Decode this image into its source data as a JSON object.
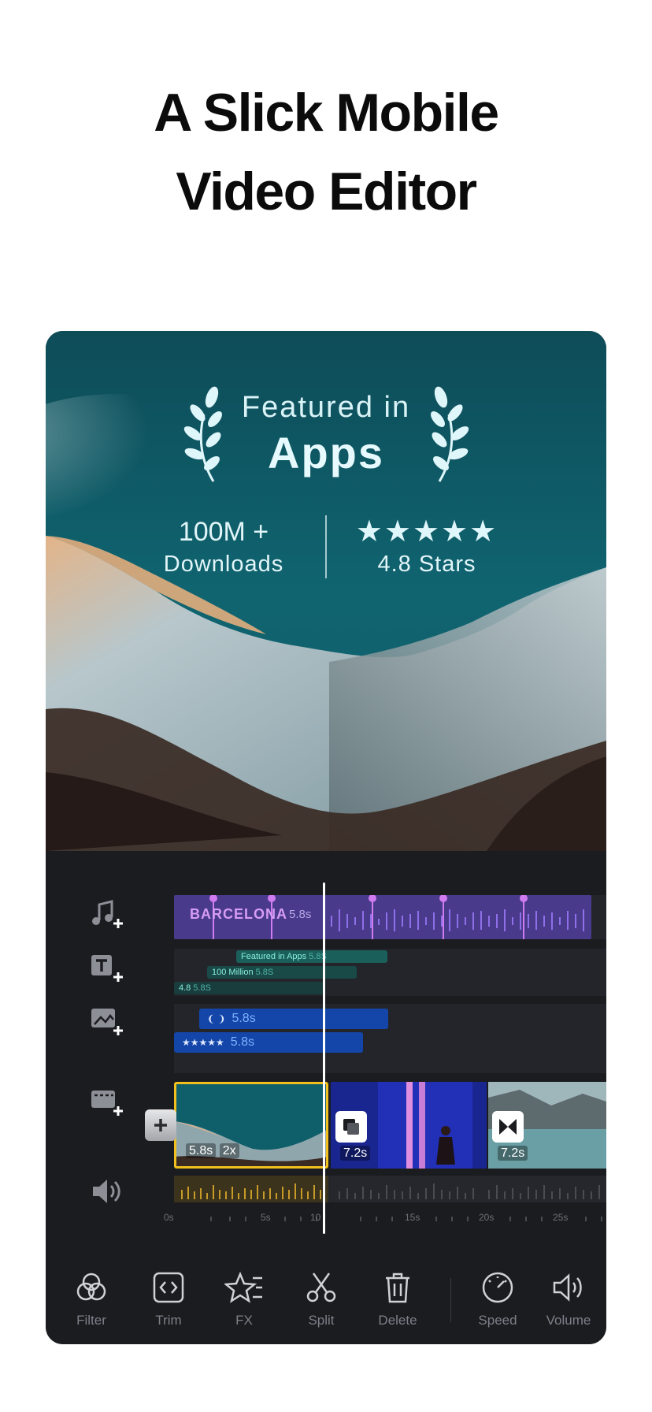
{
  "headline": {
    "line1": "A Slick Mobile",
    "line2": "Video Editor"
  },
  "hero": {
    "featured_line1": "Featured in",
    "featured_line2": "Apps",
    "downloads_value": "100M +",
    "downloads_label": "Downloads",
    "stars_glyphs": "★★★★★",
    "stars_label": "4.8 Stars"
  },
  "timeline": {
    "music_clip": {
      "title": "BARCELONA",
      "duration": "5.8s"
    },
    "text_clips": [
      {
        "label": "Featured in Apps",
        "duration": "5.8S"
      },
      {
        "label": "100 Million",
        "duration": "5.8S"
      },
      {
        "label": "4.8",
        "duration": "5.8S"
      }
    ],
    "image_clips": [
      {
        "glyph": "❨ ❩",
        "duration": "5.8s"
      },
      {
        "glyph": "★★★★★",
        "duration": "5.8s"
      }
    ],
    "video_clips": [
      {
        "duration": "5.8s",
        "speed": "2x"
      },
      {
        "duration": "7.2s"
      },
      {
        "duration": "7.2s"
      }
    ],
    "ruler_labels": [
      "0s",
      "5s",
      "10",
      "15s",
      "20s",
      "25s"
    ]
  },
  "toolbar": {
    "items": [
      {
        "label": "Filter",
        "icon": "filter-icon"
      },
      {
        "label": "Trim",
        "icon": "trim-icon"
      },
      {
        "label": "FX",
        "icon": "fx-icon"
      },
      {
        "label": "Split",
        "icon": "split-icon"
      },
      {
        "label": "Delete",
        "icon": "delete-icon"
      },
      {
        "label": "Speed",
        "icon": "speed-icon"
      },
      {
        "label": "Volume",
        "icon": "volume-icon"
      }
    ]
  },
  "colors": {
    "music_accent": "#d69cf4",
    "text_accent": "#86eede",
    "image_accent": "#7fb1ff",
    "selected_clip": "#f2c01e"
  }
}
